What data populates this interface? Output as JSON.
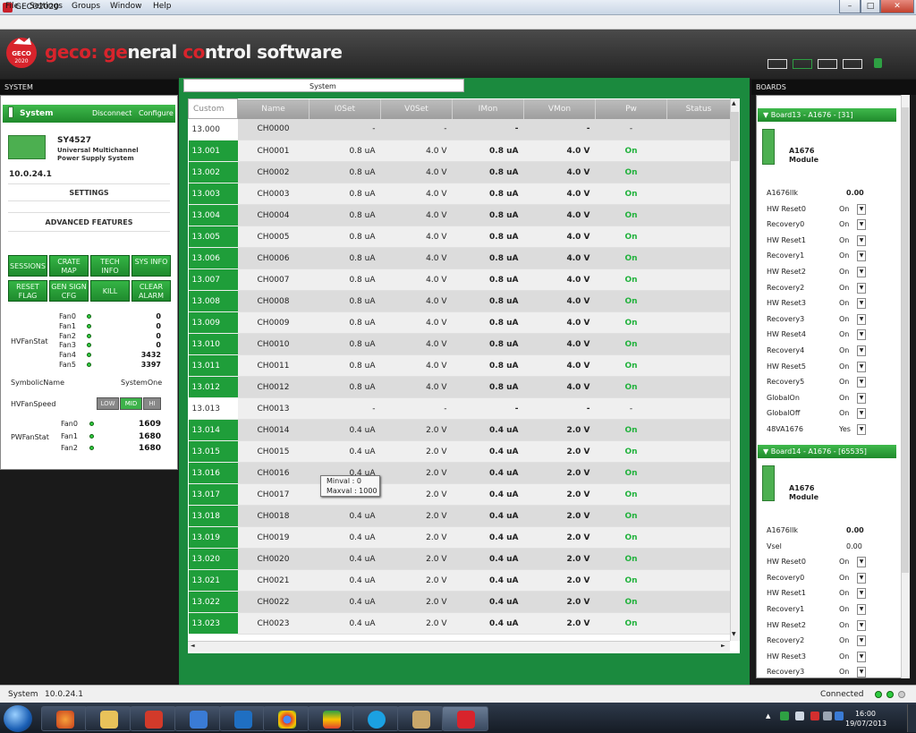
{
  "window": {
    "title": "GECO2020",
    "minimize": "–",
    "maximize": "□",
    "close": "✕"
  },
  "menu": [
    "File",
    "Settings",
    "Groups",
    "Window",
    "Help"
  ],
  "brand": {
    "part1": "geco: ",
    "part2": "ge",
    "part3": "neral ",
    "part4": "co",
    "part5": "ntrol software",
    "logo_text": "GECO 2020"
  },
  "left": {
    "header": "SYSTEM",
    "system_label": "System",
    "disconnect": "Disconnect",
    "configure": "Configure",
    "model": "SY4527",
    "desc1": "Universal Multichannel",
    "desc2": "Power Supply System",
    "version": "10.0.24.1",
    "settings": "SETTINGS",
    "advanced": "ADVANCED FEATURES",
    "buttons": [
      "SESSIONS",
      "CRATE MAP",
      "TECH INFO",
      "SYS INFO",
      "RESET FLAG",
      "GEN SIGN CFG",
      "KILL",
      "CLEAR ALARM"
    ],
    "hvfanstat_label": "HVFanStat",
    "fans": [
      {
        "name": "Fan0",
        "value": "0"
      },
      {
        "name": "Fan1",
        "value": "0"
      },
      {
        "name": "Fan2",
        "value": "0"
      },
      {
        "name": "Fan3",
        "value": "0"
      },
      {
        "name": "Fan4",
        "value": "3432"
      },
      {
        "name": "Fan5",
        "value": "3397"
      }
    ],
    "symbolic_label": "SymbolicName",
    "symbolic_value": "SystemOne",
    "hvfanspeed_label": "HVFanSpeed",
    "speed": [
      "LOW",
      "MID",
      "HI"
    ],
    "pwfanstat_label": "PWFanStat",
    "pwfans": [
      {
        "name": "Fan0",
        "value": "1609"
      },
      {
        "name": "Fan1",
        "value": "1680"
      },
      {
        "name": "Fan2",
        "value": "1680"
      }
    ]
  },
  "center": {
    "tab": "System",
    "custom": "Custom",
    "columns": [
      "Name",
      "I0Set",
      "V0Set",
      "IMon",
      "VMon",
      "Pw",
      "Status"
    ],
    "rows": [
      {
        "id": "13.000",
        "name": "CH0000",
        "i0": "-",
        "v0": "-",
        "imon": "-",
        "vmon": "-",
        "pw": "-",
        "status": "",
        "enabled": false
      },
      {
        "id": "13.001",
        "name": "CH0001",
        "i0": "0.8 uA",
        "v0": "4.0  V",
        "imon": "0.8 uA",
        "vmon": "4.0  V",
        "pw": "On",
        "status": "",
        "enabled": true
      },
      {
        "id": "13.002",
        "name": "CH0002",
        "i0": "0.8 uA",
        "v0": "4.0  V",
        "imon": "0.8 uA",
        "vmon": "4.0  V",
        "pw": "On",
        "status": "",
        "enabled": true
      },
      {
        "id": "13.003",
        "name": "CH0003",
        "i0": "0.8 uA",
        "v0": "4.0  V",
        "imon": "0.8 uA",
        "vmon": "4.0  V",
        "pw": "On",
        "status": "",
        "enabled": true
      },
      {
        "id": "13.004",
        "name": "CH0004",
        "i0": "0.8 uA",
        "v0": "4.0  V",
        "imon": "0.8 uA",
        "vmon": "4.0  V",
        "pw": "On",
        "status": "",
        "enabled": true
      },
      {
        "id": "13.005",
        "name": "CH0005",
        "i0": "0.8 uA",
        "v0": "4.0  V",
        "imon": "0.8 uA",
        "vmon": "4.0  V",
        "pw": "On",
        "status": "",
        "enabled": true
      },
      {
        "id": "13.006",
        "name": "CH0006",
        "i0": "0.8 uA",
        "v0": "4.0  V",
        "imon": "0.8 uA",
        "vmon": "4.0  V",
        "pw": "On",
        "status": "",
        "enabled": true
      },
      {
        "id": "13.007",
        "name": "CH0007",
        "i0": "0.8 uA",
        "v0": "4.0  V",
        "imon": "0.8 uA",
        "vmon": "4.0  V",
        "pw": "On",
        "status": "",
        "enabled": true
      },
      {
        "id": "13.008",
        "name": "CH0008",
        "i0": "0.8 uA",
        "v0": "4.0  V",
        "imon": "0.8 uA",
        "vmon": "4.0  V",
        "pw": "On",
        "status": "",
        "enabled": true
      },
      {
        "id": "13.009",
        "name": "CH0009",
        "i0": "0.8 uA",
        "v0": "4.0  V",
        "imon": "0.8 uA",
        "vmon": "4.0  V",
        "pw": "On",
        "status": "",
        "enabled": true
      },
      {
        "id": "13.010",
        "name": "CH0010",
        "i0": "0.8 uA",
        "v0": "4.0  V",
        "imon": "0.8 uA",
        "vmon": "4.0  V",
        "pw": "On",
        "status": "",
        "enabled": true
      },
      {
        "id": "13.011",
        "name": "CH0011",
        "i0": "0.8 uA",
        "v0": "4.0  V",
        "imon": "0.8 uA",
        "vmon": "4.0  V",
        "pw": "On",
        "status": "",
        "enabled": true
      },
      {
        "id": "13.012",
        "name": "CH0012",
        "i0": "0.8 uA",
        "v0": "4.0  V",
        "imon": "0.8 uA",
        "vmon": "4.0  V",
        "pw": "On",
        "status": "",
        "enabled": true
      },
      {
        "id": "13.013",
        "name": "CH0013",
        "i0": "-",
        "v0": "-",
        "imon": "-",
        "vmon": "-",
        "pw": "-",
        "status": "",
        "enabled": false
      },
      {
        "id": "13.014",
        "name": "CH0014",
        "i0": "0.4 uA",
        "v0": "2.0  V",
        "imon": "0.4 uA",
        "vmon": "2.0  V",
        "pw": "On",
        "status": "",
        "enabled": true
      },
      {
        "id": "13.015",
        "name": "CH0015",
        "i0": "0.4 uA",
        "v0": "2.0  V",
        "imon": "0.4 uA",
        "vmon": "2.0  V",
        "pw": "On",
        "status": "",
        "enabled": true
      },
      {
        "id": "13.016",
        "name": "CH0016",
        "i0": "0.4 uA",
        "v0": "2.0  V",
        "imon": "0.4 uA",
        "vmon": "2.0  V",
        "pw": "On",
        "status": "",
        "enabled": true
      },
      {
        "id": "13.017",
        "name": "CH0017",
        "i0": "0.4 uA",
        "v0": "2.0  V",
        "imon": "0.4 uA",
        "vmon": "2.0  V",
        "pw": "On",
        "status": "",
        "enabled": true
      },
      {
        "id": "13.018",
        "name": "CH0018",
        "i0": "0.4 uA",
        "v0": "2.0  V",
        "imon": "0.4 uA",
        "vmon": "2.0  V",
        "pw": "On",
        "status": "",
        "enabled": true
      },
      {
        "id": "13.019",
        "name": "CH0019",
        "i0": "0.4 uA",
        "v0": "2.0  V",
        "imon": "0.4 uA",
        "vmon": "2.0  V",
        "pw": "On",
        "status": "",
        "enabled": true
      },
      {
        "id": "13.020",
        "name": "CH0020",
        "i0": "0.4 uA",
        "v0": "2.0  V",
        "imon": "0.4 uA",
        "vmon": "2.0  V",
        "pw": "On",
        "status": "",
        "enabled": true
      },
      {
        "id": "13.021",
        "name": "CH0021",
        "i0": "0.4 uA",
        "v0": "2.0  V",
        "imon": "0.4 uA",
        "vmon": "2.0  V",
        "pw": "On",
        "status": "",
        "enabled": true
      },
      {
        "id": "13.022",
        "name": "CH0022",
        "i0": "0.4 uA",
        "v0": "2.0  V",
        "imon": "0.4 uA",
        "vmon": "2.0  V",
        "pw": "On",
        "status": "",
        "enabled": true
      },
      {
        "id": "13.023",
        "name": "CH0023",
        "i0": "0.4 uA",
        "v0": "2.0  V",
        "imon": "0.4 uA",
        "vmon": "2.0  V",
        "pw": "On",
        "status": "",
        "enabled": true
      }
    ],
    "tooltip": {
      "line1": "Minval : 0",
      "line2": "Maxval : 1000"
    }
  },
  "right": {
    "header": "BOARDS",
    "board13": {
      "title": "Board13 - A1676 - [31]",
      "module1": "A1676",
      "module2": "Module",
      "params": [
        {
          "label": "A1676Ilk",
          "value": "0.00",
          "dd": false
        },
        {
          "label": "HW Reset0",
          "value": "On",
          "dd": true
        },
        {
          "label": "Recovery0",
          "value": "On",
          "dd": true
        },
        {
          "label": "HW Reset1",
          "value": "On",
          "dd": true
        },
        {
          "label": "Recovery1",
          "value": "On",
          "dd": true
        },
        {
          "label": "HW Reset2",
          "value": "On",
          "dd": true
        },
        {
          "label": "Recovery2",
          "value": "On",
          "dd": true
        },
        {
          "label": "HW Reset3",
          "value": "On",
          "dd": true
        },
        {
          "label": "Recovery3",
          "value": "On",
          "dd": true
        },
        {
          "label": "HW Reset4",
          "value": "On",
          "dd": true
        },
        {
          "label": "Recovery4",
          "value": "On",
          "dd": true
        },
        {
          "label": "HW Reset5",
          "value": "On",
          "dd": true
        },
        {
          "label": "Recovery5",
          "value": "On",
          "dd": true
        },
        {
          "label": "GlobalOn",
          "value": "On",
          "dd": true
        },
        {
          "label": "GlobalOff",
          "value": "On",
          "dd": true
        },
        {
          "label": "48VA1676",
          "value": "Yes",
          "dd": true
        }
      ]
    },
    "board14": {
      "title": "Board14 - A1676 - [65535]",
      "module1": "A1676",
      "module2": "Module",
      "params": [
        {
          "label": "A1676Ilk",
          "value": "0.00",
          "dd": false
        },
        {
          "label": "Vsel",
          "value": "0.00",
          "dd": false
        },
        {
          "label": "HW Reset0",
          "value": "On",
          "dd": true
        },
        {
          "label": "Recovery0",
          "value": "On",
          "dd": true
        },
        {
          "label": "HW Reset1",
          "value": "On",
          "dd": true
        },
        {
          "label": "Recovery1",
          "value": "On",
          "dd": true
        },
        {
          "label": "HW Reset2",
          "value": "On",
          "dd": true
        },
        {
          "label": "Recovery2",
          "value": "On",
          "dd": true
        },
        {
          "label": "HW Reset3",
          "value": "On",
          "dd": true
        },
        {
          "label": "Recovery3",
          "value": "On",
          "dd": true
        }
      ]
    }
  },
  "status": {
    "left1": "System",
    "left2": "10.0.24.1",
    "right": "Connected"
  },
  "taskbar": {
    "time": "16:00",
    "date": "19/07/2013"
  }
}
